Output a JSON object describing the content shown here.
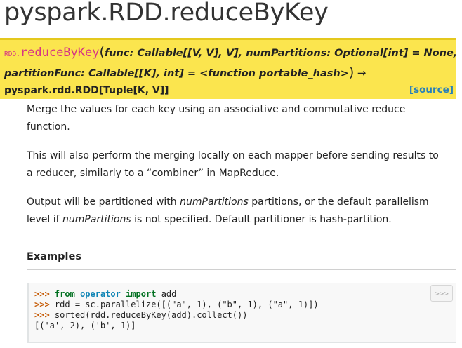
{
  "title": "pyspark.RDD.reduceByKey",
  "signature": {
    "prefix": "RDD.",
    "name": "reduceByKey",
    "open_paren": "(",
    "params_line1": "func: Callable[[V, V], V], numPartitions: Optional[int] = None,",
    "params_line2": "partitionFunc: Callable[[K], int] = <function portable_hash>",
    "close_paren": ")",
    "arrow": "→",
    "return_type": "pyspark.rdd.RDD[Tuple[K, V]]",
    "source_label": "[source]"
  },
  "description": {
    "p1": "Merge the values for each key using an associative and commutative reduce function.",
    "p2": "This will also perform the merging locally on each mapper before sending results to a reducer, similarly to a “combiner” in MapReduce.",
    "p3_a": "Output will be partitioned with ",
    "p3_em1": "numPartitions",
    "p3_b": " partitions, or the default parallelism level if ",
    "p3_em2": "numPartitions",
    "p3_c": " is not specified. Default partitioner is hash-partition."
  },
  "examples": {
    "heading": "Examples",
    "copy_label": ">>>",
    "lines": [
      {
        "prompt": ">>>",
        "kw1": "from",
        "mod": "operator",
        "kw2": "import",
        "rest": "add"
      },
      {
        "prompt": ">>>",
        "code": "rdd = sc.parallelize([(\"a\", 1), (\"b\", 1), (\"a\", 1)])"
      },
      {
        "prompt": ">>>",
        "code": "sorted(rdd.reduceByKey(add).collect())"
      },
      {
        "output": "[('a', 2), ('b', 1)]"
      }
    ]
  },
  "colors": {
    "signature_bg": "#fbe54e",
    "function_name": "#d63384",
    "link": "#2980b9"
  }
}
